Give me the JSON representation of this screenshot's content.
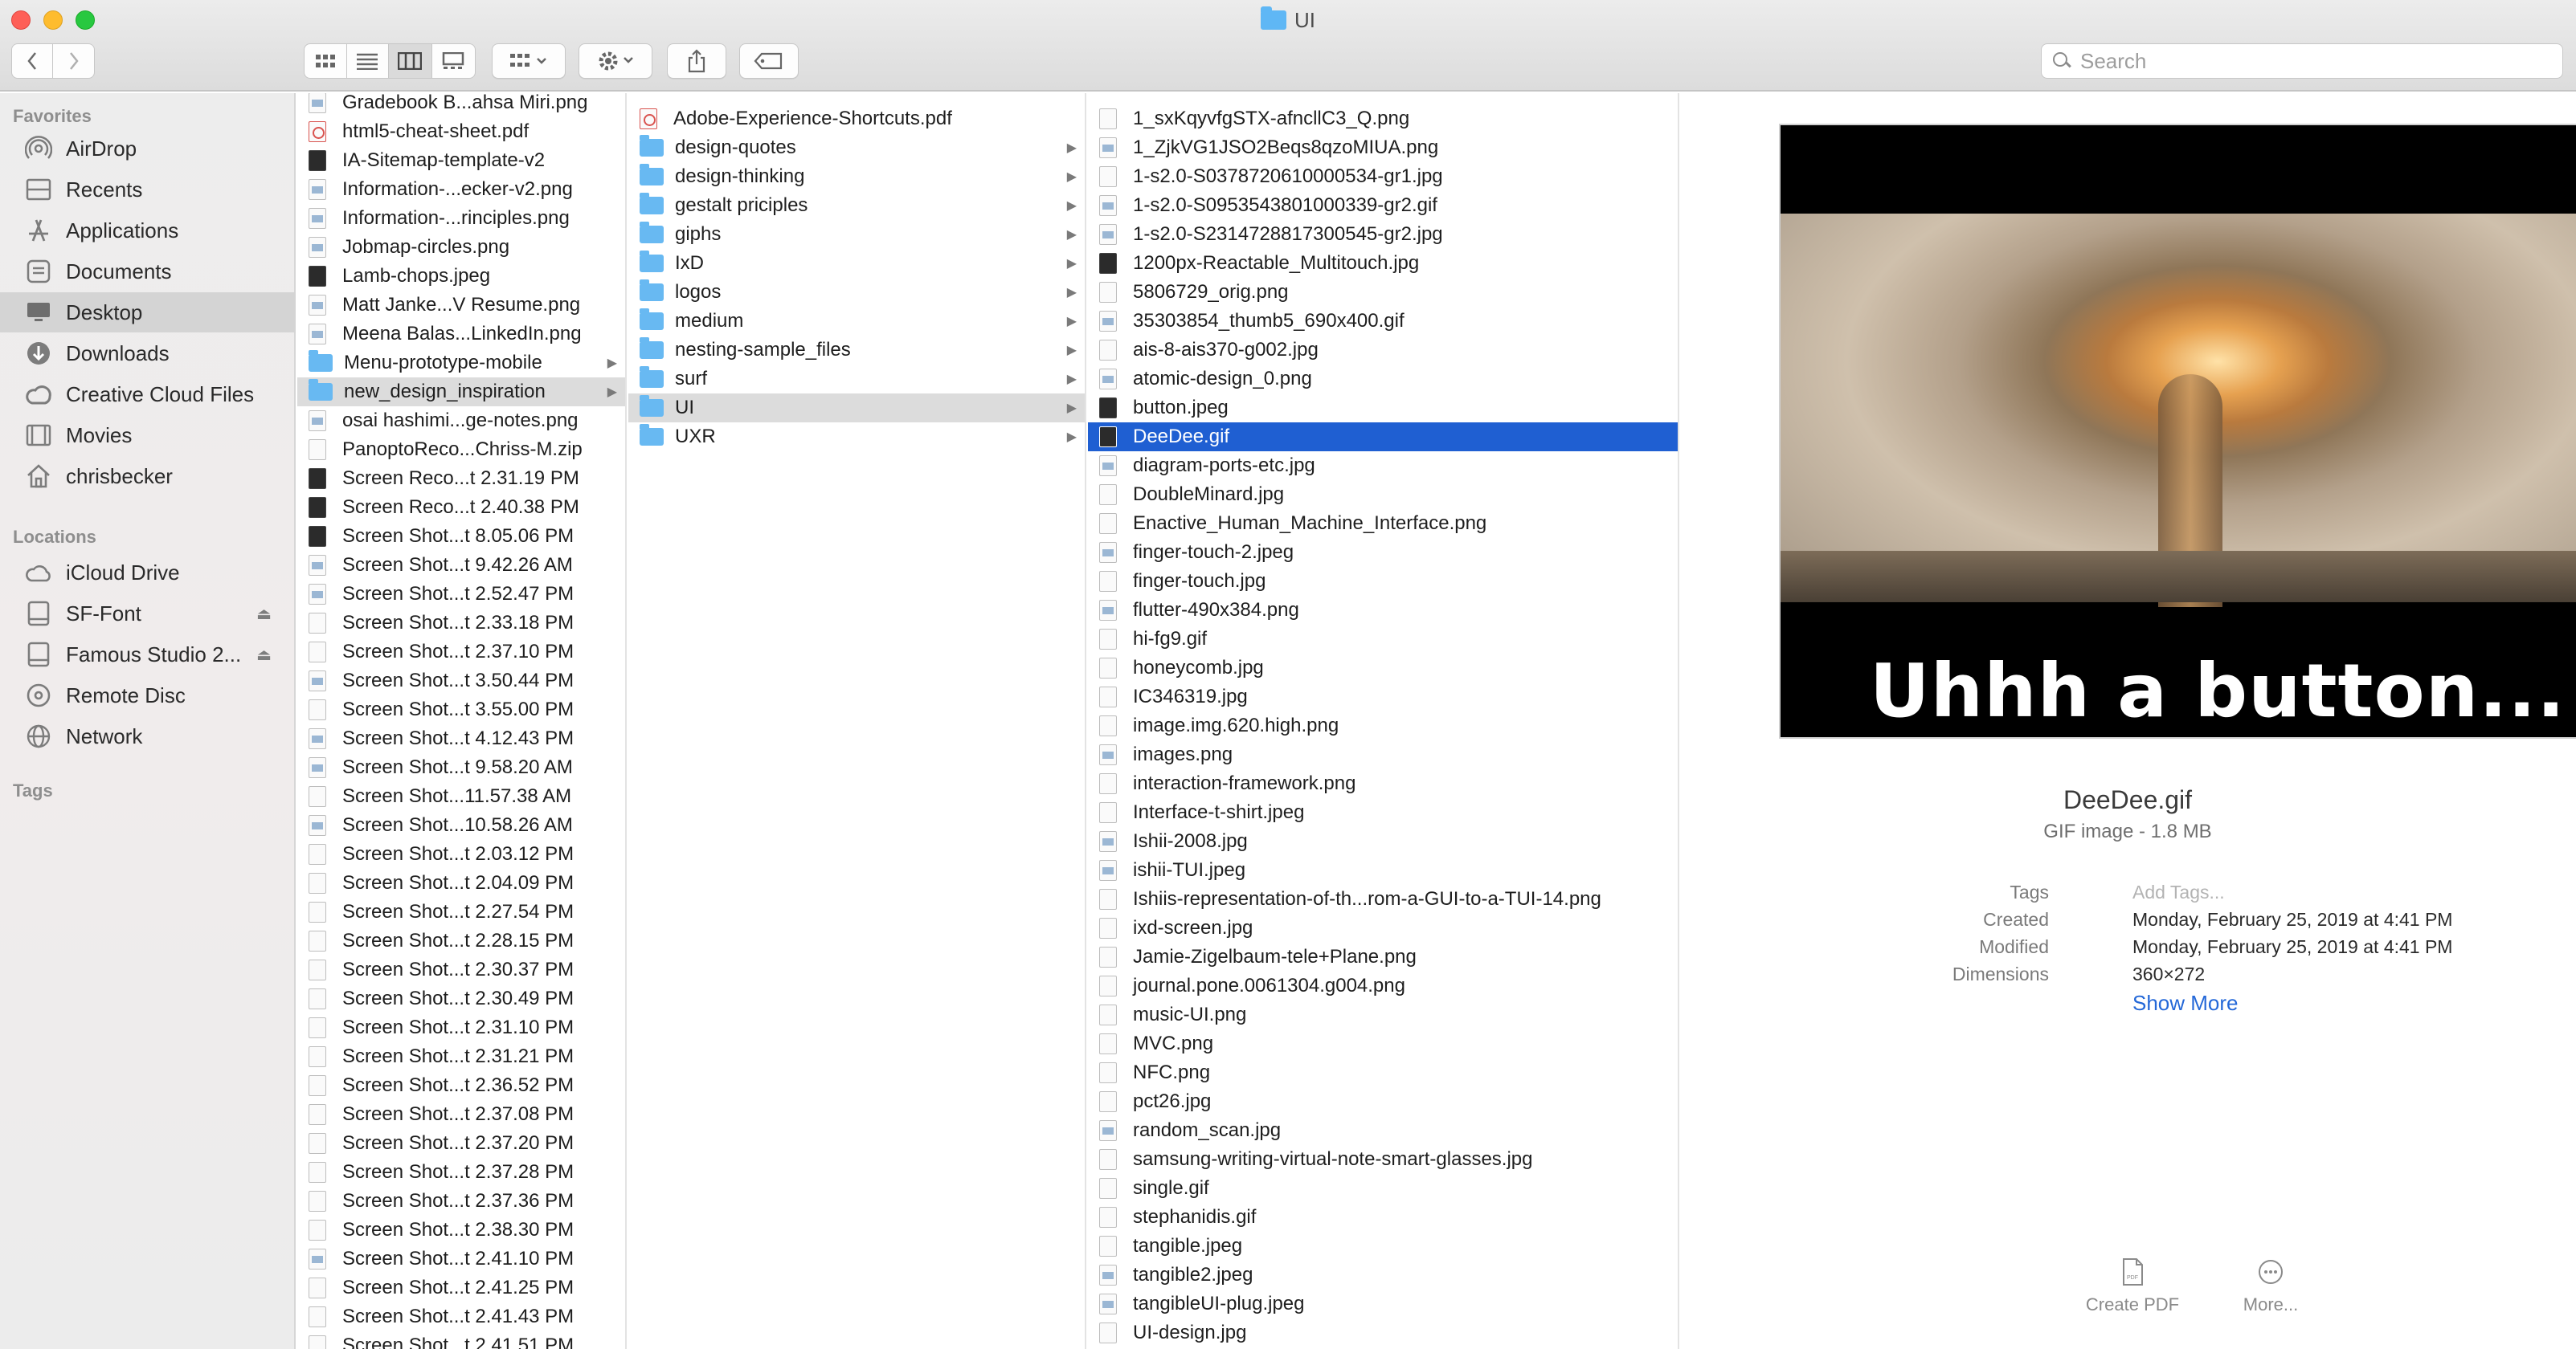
{
  "window": {
    "title": "UI"
  },
  "toolbar": {
    "back_icon": "chevron-left-icon",
    "forward_icon": "chevron-right-icon",
    "view_modes": [
      "icon-view-icon",
      "list-view-icon",
      "column-view-icon",
      "gallery-view-icon"
    ],
    "active_view": "column",
    "group_icon": "group-by-icon",
    "action_icon": "gear-icon",
    "share_icon": "share-icon",
    "tag_icon": "tag-icon",
    "search_placeholder": "Search"
  },
  "sidebar": {
    "favorites_header": "Favorites",
    "favorites": [
      {
        "label": "AirDrop",
        "icon": "airdrop-icon"
      },
      {
        "label": "Recents",
        "icon": "recents-icon"
      },
      {
        "label": "Applications",
        "icon": "applications-icon"
      },
      {
        "label": "Documents",
        "icon": "documents-icon"
      },
      {
        "label": "Desktop",
        "icon": "desktop-icon",
        "selected": true
      },
      {
        "label": "Downloads",
        "icon": "downloads-icon"
      },
      {
        "label": "Creative Cloud Files",
        "icon": "creative-cloud-icon"
      },
      {
        "label": "Movies",
        "icon": "movies-icon"
      },
      {
        "label": "chrisbecker",
        "icon": "home-icon"
      }
    ],
    "locations_header": "Locations",
    "locations": [
      {
        "label": "iCloud Drive",
        "icon": "icloud-icon"
      },
      {
        "label": "SF-Font",
        "icon": "disk-icon",
        "eject": true
      },
      {
        "label": "Famous Studio 2...",
        "icon": "disk-icon",
        "eject": true
      },
      {
        "label": "Remote Disc",
        "icon": "remote-disc-icon"
      },
      {
        "label": "Network",
        "icon": "network-icon"
      }
    ],
    "tags_header": "Tags"
  },
  "column1": [
    {
      "name": "Gradebook B...ahsa Miri.png",
      "kind": "img"
    },
    {
      "name": "html5-cheat-sheet.pdf",
      "kind": "pdf"
    },
    {
      "name": "IA-Sitemap-template-v2",
      "kind": "dark"
    },
    {
      "name": "Information-...ecker-v2.png",
      "kind": "img"
    },
    {
      "name": "Information-...rinciples.png",
      "kind": "img"
    },
    {
      "name": "Jobmap-circles.png",
      "kind": "img"
    },
    {
      "name": "Lamb-chops.jpeg",
      "kind": "dark"
    },
    {
      "name": "Matt Janke...V Resume.png",
      "kind": "img"
    },
    {
      "name": "Meena Balas...LinkedIn.png",
      "kind": "img"
    },
    {
      "name": "Menu-prototype-mobile",
      "kind": "folder",
      "arrow": true
    },
    {
      "name": "new_design_inspiration",
      "kind": "folder",
      "arrow": true,
      "selected": true
    },
    {
      "name": "osai hashimi...ge-notes.png",
      "kind": "img"
    },
    {
      "name": "PanoptoReco...Chriss-M.zip",
      "kind": "file"
    },
    {
      "name": "Screen Reco...t 2.31.19 PM",
      "kind": "dark"
    },
    {
      "name": "Screen Reco...t 2.40.38 PM",
      "kind": "dark"
    },
    {
      "name": "Screen Shot...t 8.05.06 PM",
      "kind": "dark"
    },
    {
      "name": "Screen Shot...t 9.42.26 AM",
      "kind": "img"
    },
    {
      "name": "Screen Shot...t 2.52.47 PM",
      "kind": "img"
    },
    {
      "name": "Screen Shot...t 2.33.18 PM",
      "kind": "file"
    },
    {
      "name": "Screen Shot...t 2.37.10 PM",
      "kind": "file"
    },
    {
      "name": "Screen Shot...t 3.50.44 PM",
      "kind": "img"
    },
    {
      "name": "Screen Shot...t 3.55.00 PM",
      "kind": "file"
    },
    {
      "name": "Screen Shot...t 4.12.43 PM",
      "kind": "img"
    },
    {
      "name": "Screen Shot...t 9.58.20 AM",
      "kind": "img"
    },
    {
      "name": "Screen Shot...11.57.38 AM",
      "kind": "file"
    },
    {
      "name": "Screen Shot...10.58.26 AM",
      "kind": "img"
    },
    {
      "name": "Screen Shot...t 2.03.12 PM",
      "kind": "file"
    },
    {
      "name": "Screen Shot...t 2.04.09 PM",
      "kind": "file"
    },
    {
      "name": "Screen Shot...t 2.27.54 PM",
      "kind": "file"
    },
    {
      "name": "Screen Shot...t 2.28.15 PM",
      "kind": "file"
    },
    {
      "name": "Screen Shot...t 2.30.37 PM",
      "kind": "file"
    },
    {
      "name": "Screen Shot...t 2.30.49 PM",
      "kind": "file"
    },
    {
      "name": "Screen Shot...t 2.31.10 PM",
      "kind": "file"
    },
    {
      "name": "Screen Shot...t 2.31.21 PM",
      "kind": "file"
    },
    {
      "name": "Screen Shot...t 2.36.52 PM",
      "kind": "file"
    },
    {
      "name": "Screen Shot...t 2.37.08 PM",
      "kind": "file"
    },
    {
      "name": "Screen Shot...t 2.37.20 PM",
      "kind": "file"
    },
    {
      "name": "Screen Shot...t 2.37.28 PM",
      "kind": "file"
    },
    {
      "name": "Screen Shot...t 2.37.36 PM",
      "kind": "file"
    },
    {
      "name": "Screen Shot...t 2.38.30 PM",
      "kind": "file"
    },
    {
      "name": "Screen Shot...t 2.41.10 PM",
      "kind": "img"
    },
    {
      "name": "Screen Shot...t 2.41.25 PM",
      "kind": "file"
    },
    {
      "name": "Screen Shot...t 2.41.43 PM",
      "kind": "file"
    },
    {
      "name": "Screen Shot...t 2.41.51 PM",
      "kind": "file"
    }
  ],
  "column2": [
    {
      "name": "Adobe-Experience-Shortcuts.pdf",
      "kind": "pdf"
    },
    {
      "name": "design-quotes",
      "kind": "folder",
      "arrow": true
    },
    {
      "name": "design-thinking",
      "kind": "folder",
      "arrow": true
    },
    {
      "name": "gestalt priciples",
      "kind": "folder",
      "arrow": true
    },
    {
      "name": "giphs",
      "kind": "folder",
      "arrow": true
    },
    {
      "name": "IxD",
      "kind": "folder",
      "arrow": true
    },
    {
      "name": "logos",
      "kind": "folder",
      "arrow": true
    },
    {
      "name": "medium",
      "kind": "folder",
      "arrow": true
    },
    {
      "name": "nesting-sample_files",
      "kind": "folder",
      "arrow": true
    },
    {
      "name": "surf",
      "kind": "folder",
      "arrow": true
    },
    {
      "name": "UI",
      "kind": "folder",
      "arrow": true,
      "selected": true
    },
    {
      "name": "UXR",
      "kind": "folder",
      "arrow": true
    }
  ],
  "column3": [
    {
      "name": "1_sxKqyvfgSTX-afncllC3_Q.png",
      "kind": "file"
    },
    {
      "name": "1_ZjkVG1JSO2Beqs8qzoMIUA.png",
      "kind": "img"
    },
    {
      "name": "1-s2.0-S0378720610000534-gr1.jpg",
      "kind": "file"
    },
    {
      "name": "1-s2.0-S0953543801000339-gr2.gif",
      "kind": "img"
    },
    {
      "name": "1-s2.0-S2314728817300545-gr2.jpg",
      "kind": "img"
    },
    {
      "name": "1200px-Reactable_Multitouch.jpg",
      "kind": "dark"
    },
    {
      "name": "5806729_orig.png",
      "kind": "file"
    },
    {
      "name": "35303854_thumb5_690x400.gif",
      "kind": "img"
    },
    {
      "name": "ais-8-ais370-g002.jpg",
      "kind": "file"
    },
    {
      "name": "atomic-design_0.png",
      "kind": "img"
    },
    {
      "name": "button.jpeg",
      "kind": "dark"
    },
    {
      "name": "DeeDee.gif",
      "kind": "dark",
      "selected": true
    },
    {
      "name": "diagram-ports-etc.jpg",
      "kind": "img"
    },
    {
      "name": "DoubleMinard.jpg",
      "kind": "file"
    },
    {
      "name": "Enactive_Human_Machine_Interface.png",
      "kind": "file"
    },
    {
      "name": "finger-touch-2.jpeg",
      "kind": "img"
    },
    {
      "name": "finger-touch.jpg",
      "kind": "file"
    },
    {
      "name": "flutter-490x384.png",
      "kind": "img"
    },
    {
      "name": "hi-fg9.gif",
      "kind": "file"
    },
    {
      "name": "honeycomb.jpg",
      "kind": "file"
    },
    {
      "name": "IC346319.jpg",
      "kind": "file"
    },
    {
      "name": "image.img.620.high.png",
      "kind": "file"
    },
    {
      "name": "images.png",
      "kind": "img"
    },
    {
      "name": "interaction-framework.png",
      "kind": "file"
    },
    {
      "name": "Interface-t-shirt.jpeg",
      "kind": "file"
    },
    {
      "name": "Ishii-2008.jpg",
      "kind": "img"
    },
    {
      "name": "ishii-TUI.jpeg",
      "kind": "img"
    },
    {
      "name": "Ishiis-representation-of-th...rom-a-GUI-to-a-TUI-14.png",
      "kind": "file"
    },
    {
      "name": "ixd-screen.jpg",
      "kind": "file"
    },
    {
      "name": "Jamie-Zigelbaum-tele+Plane.png",
      "kind": "file"
    },
    {
      "name": "journal.pone.0061304.g004.png",
      "kind": "file"
    },
    {
      "name": "music-UI.png",
      "kind": "file"
    },
    {
      "name": "MVC.png",
      "kind": "file"
    },
    {
      "name": "NFC.png",
      "kind": "file"
    },
    {
      "name": "pct26.jpg",
      "kind": "file"
    },
    {
      "name": "random_scan.jpg",
      "kind": "img"
    },
    {
      "name": "samsung-writing-virtual-note-smart-glasses.jpg",
      "kind": "file"
    },
    {
      "name": "single.gif",
      "kind": "file"
    },
    {
      "name": "stephanidis.gif",
      "kind": "file"
    },
    {
      "name": "tangible.jpeg",
      "kind": "file"
    },
    {
      "name": "tangible2.jpeg",
      "kind": "img"
    },
    {
      "name": "tangibleUI-plug.jpeg",
      "kind": "img"
    },
    {
      "name": "UI-design.jpg",
      "kind": "file"
    }
  ],
  "preview": {
    "image_caption": "Uhhh a button...",
    "file_name": "DeeDee.gif",
    "file_kind": "GIF image - 1.8 MB",
    "tags_label": "Tags",
    "tags_placeholder": "Add Tags...",
    "created_label": "Created",
    "created_value": "Monday, February 25, 2019 at 4:41 PM",
    "modified_label": "Modified",
    "modified_value": "Monday, February 25, 2019 at 4:41 PM",
    "dimensions_label": "Dimensions",
    "dimensions_value": "360×272",
    "show_more": "Show More",
    "actions": [
      {
        "label": "Create PDF",
        "icon": "create-pdf-icon"
      },
      {
        "label": "More...",
        "icon": "more-icon"
      }
    ]
  },
  "colors": {
    "selection_blue": "#1f5fd2",
    "selection_gray": "#dcdcdc",
    "folder_blue": "#68b9f2",
    "link_blue": "#2468d8"
  }
}
